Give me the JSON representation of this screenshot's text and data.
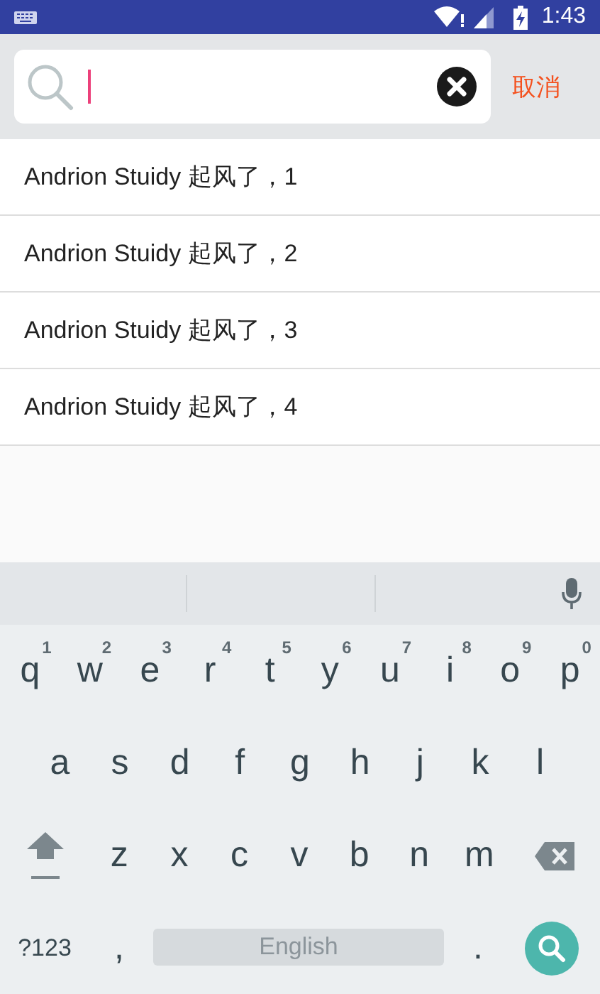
{
  "status_bar": {
    "time": "1:43"
  },
  "search": {
    "focused": true,
    "cancel": "取消"
  },
  "results": [
    "Andrion Stuidy 起风了，1",
    "Andrion Stuidy 起风了，2",
    "Andrion Stuidy 起风了，3",
    "Andrion Stuidy 起风了，4"
  ],
  "keyboard": {
    "rows": [
      {
        "keys": [
          {
            "label": "q",
            "hint": "1"
          },
          {
            "label": "w",
            "hint": "2"
          },
          {
            "label": "e",
            "hint": "3"
          },
          {
            "label": "r",
            "hint": "4"
          },
          {
            "label": "t",
            "hint": "5"
          },
          {
            "label": "y",
            "hint": "6"
          },
          {
            "label": "u",
            "hint": "7"
          },
          {
            "label": "i",
            "hint": "8"
          },
          {
            "label": "o",
            "hint": "9"
          },
          {
            "label": "p",
            "hint": "0"
          }
        ]
      },
      {
        "keys": [
          {
            "label": "a"
          },
          {
            "label": "s"
          },
          {
            "label": "d"
          },
          {
            "label": "f"
          },
          {
            "label": "g"
          },
          {
            "label": "h"
          },
          {
            "label": "j"
          },
          {
            "label": "k"
          },
          {
            "label": "l"
          }
        ]
      },
      {
        "keys": [
          {
            "label": "z"
          },
          {
            "label": "x"
          },
          {
            "label": "c"
          },
          {
            "label": "v"
          },
          {
            "label": "b"
          },
          {
            "label": "n"
          },
          {
            "label": "m"
          }
        ]
      }
    ],
    "symbols": "?123",
    "comma": ",",
    "space": "English",
    "period": "."
  }
}
